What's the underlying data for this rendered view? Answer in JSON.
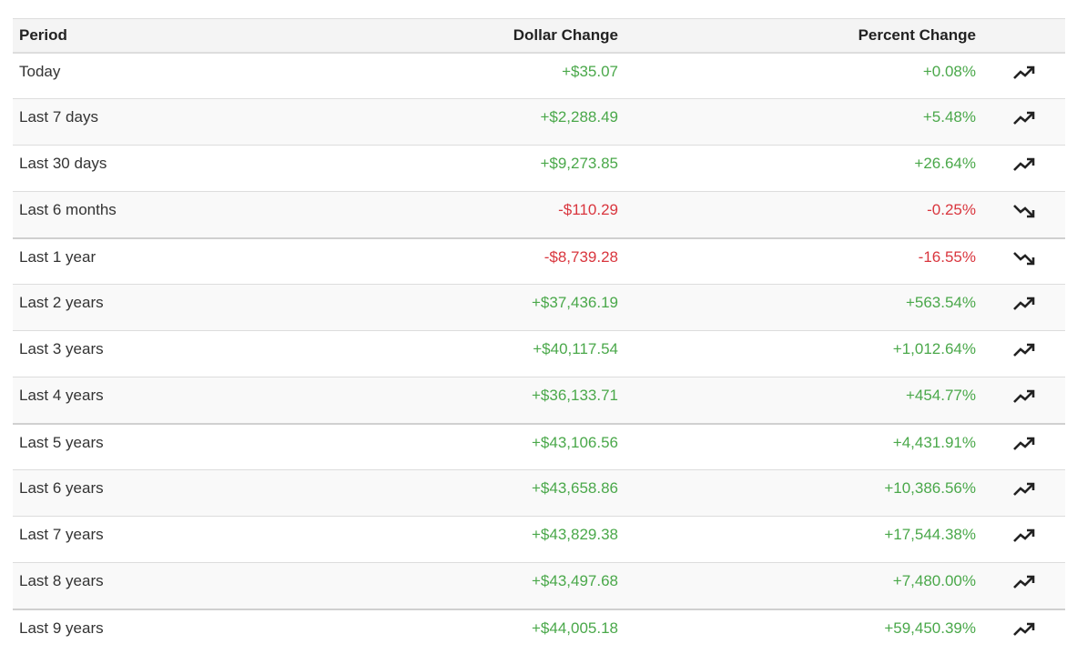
{
  "table": {
    "headers": {
      "period": "Period",
      "dollar": "Dollar Change",
      "percent": "Percent Change"
    },
    "rows": [
      {
        "period": "Today",
        "dollar": "+$35.07",
        "percent": "+0.08%",
        "direction": "up",
        "icon": "trending-up-icon"
      },
      {
        "period": "Last 7 days",
        "dollar": "+$2,288.49",
        "percent": "+5.48%",
        "direction": "up",
        "icon": "trending-up-icon"
      },
      {
        "period": "Last 30 days",
        "dollar": "+$9,273.85",
        "percent": "+26.64%",
        "direction": "up",
        "icon": "trending-up-icon"
      },
      {
        "period": "Last 6 months",
        "dollar": "-$110.29",
        "percent": "-0.25%",
        "direction": "down",
        "icon": "trending-down-icon"
      },
      {
        "period": "Last 1 year",
        "dollar": "-$8,739.28",
        "percent": "-16.55%",
        "direction": "down",
        "icon": "trending-down-icon"
      },
      {
        "period": "Last 2 years",
        "dollar": "+$37,436.19",
        "percent": "+563.54%",
        "direction": "up",
        "icon": "trending-up-icon"
      },
      {
        "period": "Last 3 years",
        "dollar": "+$40,117.54",
        "percent": "+1,012.64%",
        "direction": "up",
        "icon": "trending-up-icon"
      },
      {
        "period": "Last 4 years",
        "dollar": "+$36,133.71",
        "percent": "+454.77%",
        "direction": "up",
        "icon": "trending-up-icon"
      },
      {
        "period": "Last 5 years",
        "dollar": "+$43,106.56",
        "percent": "+4,431.91%",
        "direction": "up",
        "icon": "trending-up-icon"
      },
      {
        "period": "Last 6 years",
        "dollar": "+$43,658.86",
        "percent": "+10,386.56%",
        "direction": "up",
        "icon": "trending-up-icon"
      },
      {
        "period": "Last 7 years",
        "dollar": "+$43,829.38",
        "percent": "+17,544.38%",
        "direction": "up",
        "icon": "trending-up-icon"
      },
      {
        "period": "Last 8 years",
        "dollar": "+$43,497.68",
        "percent": "+7,480.00%",
        "direction": "up",
        "icon": "trending-up-icon"
      },
      {
        "period": "Last 9 years",
        "dollar": "+$44,005.18",
        "percent": "+59,450.39%",
        "direction": "up",
        "icon": "trending-up-icon"
      }
    ]
  },
  "colors": {
    "positive": "#4aa84a",
    "negative": "#d9363e",
    "icon": "#222222"
  }
}
